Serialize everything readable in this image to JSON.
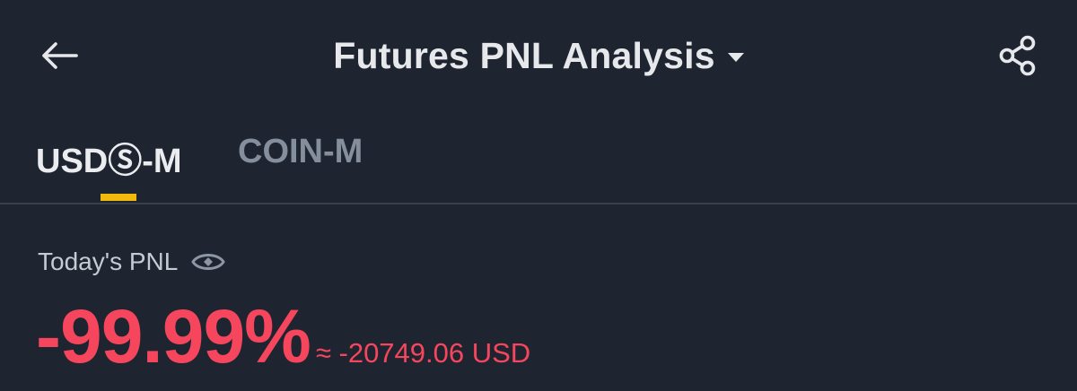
{
  "header": {
    "title": "Futures PNL Analysis",
    "back_icon": "arrow-left-icon",
    "dropdown_icon": "caret-down-icon",
    "share_icon": "share-icon"
  },
  "tabs": [
    {
      "label": "USDⓈ-M",
      "active": true
    },
    {
      "label": "COIN-M",
      "active": false
    }
  ],
  "pnl": {
    "label": "Today's PNL",
    "visibility_icon": "eye-icon",
    "percent": "-99.99%",
    "usd_value": "≈ -20749.06 USD"
  },
  "colors": {
    "background": "#1f2530",
    "accent": "#f0b90b",
    "negative": "#f6465d",
    "text_primary": "#eaecef",
    "text_secondary": "#848e9c"
  }
}
